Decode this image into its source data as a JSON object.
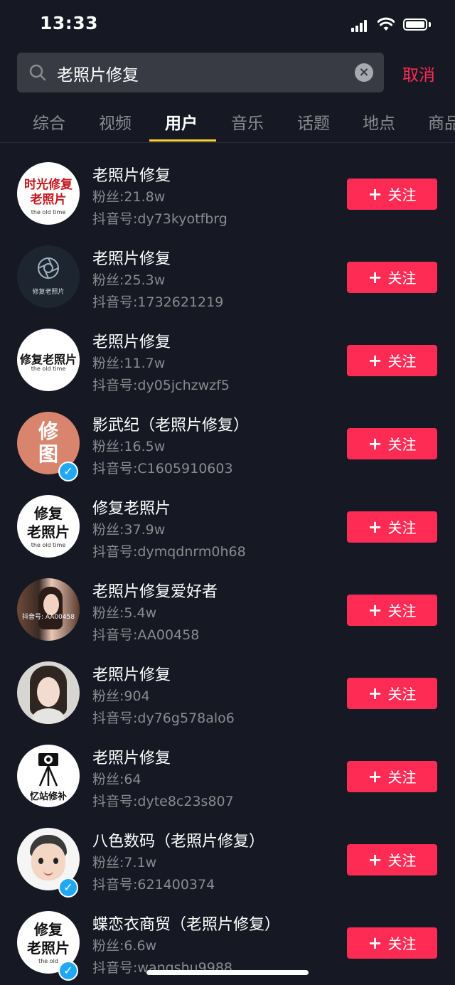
{
  "status": {
    "time": "13:33"
  },
  "search": {
    "query": "老照片修复",
    "cancel_label": "取消"
  },
  "tabs": [
    {
      "label": "综合",
      "active": false
    },
    {
      "label": "视频",
      "active": false
    },
    {
      "label": "用户",
      "active": true
    },
    {
      "label": "音乐",
      "active": false
    },
    {
      "label": "话题",
      "active": false
    },
    {
      "label": "地点",
      "active": false
    },
    {
      "label": "商品",
      "active": false
    }
  ],
  "follow_label": "关注",
  "users": [
    {
      "name": "老照片修复",
      "fans": "粉丝:21.8w",
      "douyin_id": "抖音号:dy73kyotfbrg",
      "avatar_line1": "时光修复",
      "avatar_line2": "老照片",
      "avatar_sub": "the old time",
      "verified": false
    },
    {
      "name": "老照片修复",
      "fans": "粉丝:25.3w",
      "douyin_id": "抖音号:1732621219",
      "avatar_line1": "修复老照片",
      "verified": false
    },
    {
      "name": "老照片修复",
      "fans": "粉丝:11.7w",
      "douyin_id": "抖音号:dy05jchzwzf5",
      "avatar_line1": "修复老照片",
      "avatar_sub": "the old time",
      "verified": false
    },
    {
      "name": "影武纪（老照片修复）",
      "fans": "粉丝:16.5w",
      "douyin_id": "抖音号:C1605910603",
      "avatar_line1": "修",
      "avatar_line2": "图",
      "verified": true
    },
    {
      "name": "修复老照片",
      "fans": "粉丝:37.9w",
      "douyin_id": "抖音号:dymqdnrm0h68",
      "avatar_line1": "修复",
      "avatar_line2": "老照片",
      "avatar_sub": "the old time",
      "verified": false
    },
    {
      "name": "老照片修复爱好者",
      "fans": "粉丝:5.4w",
      "douyin_id": "抖音号:AA00458",
      "avatar_line1": "抖音号: AA00458",
      "verified": false
    },
    {
      "name": "老照片修复",
      "fans": "粉丝:904",
      "douyin_id": "抖音号:dy76g578alo6",
      "verified": false
    },
    {
      "name": "老照片修复",
      "fans": "粉丝:64",
      "douyin_id": "抖音号:dyte8c23s807",
      "avatar_line1": "忆站修补",
      "verified": false
    },
    {
      "name": "八色数码（老照片修复）",
      "fans": "粉丝:7.1w",
      "douyin_id": "抖音号:621400374",
      "verified": true
    },
    {
      "name": "蝶恋衣商贸（老照片修复）",
      "fans": "粉丝:6.6w",
      "douyin_id": "抖音号:wangshu9988",
      "avatar_line1": "修复",
      "avatar_line2": "老照片",
      "avatar_sub": "the old",
      "verified": true
    }
  ]
}
